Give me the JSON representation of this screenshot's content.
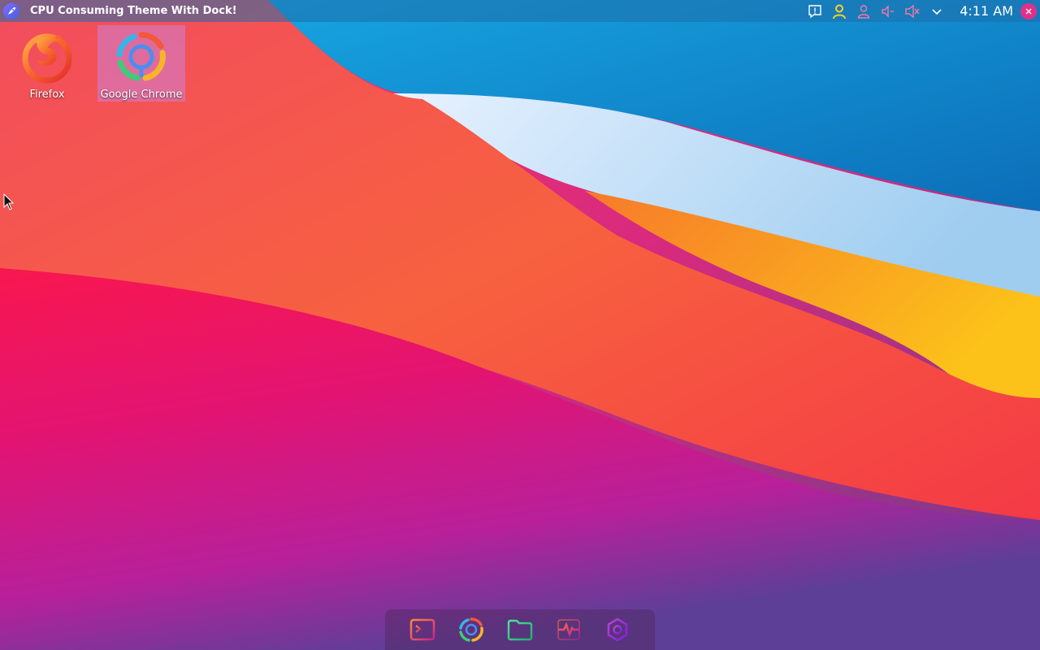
{
  "top_panel": {
    "window_title": "CPU Consuming Theme With Dock!",
    "clock": "4:11 AM",
    "tray_icons": [
      "notification-icon",
      "user-yellow-icon",
      "user-icon",
      "volume-icon",
      "mute-icon",
      "chevron-down-icon"
    ]
  },
  "desktop": {
    "icons": [
      {
        "label": "Firefox",
        "icon": "firefox-icon",
        "selected": false
      },
      {
        "label": "Google Chrome",
        "icon": "chrome-icon",
        "selected": true
      }
    ]
  },
  "dock": {
    "items": [
      "terminal-icon",
      "chrome-icon",
      "files-icon",
      "system-monitor-icon",
      "settings-icon"
    ]
  },
  "colors": {
    "panel": "#1e6eaa",
    "selection": "#cd82d7",
    "close": "#e0308a",
    "wallpaper_blue": "#1a8fd0",
    "wallpaper_red": "#f5234a",
    "wallpaper_orange": "#f98a2a",
    "wallpaper_yellow": "#fbb31c",
    "wallpaper_magenta": "#d0187c",
    "wallpaper_purple": "#7a3a8c"
  }
}
